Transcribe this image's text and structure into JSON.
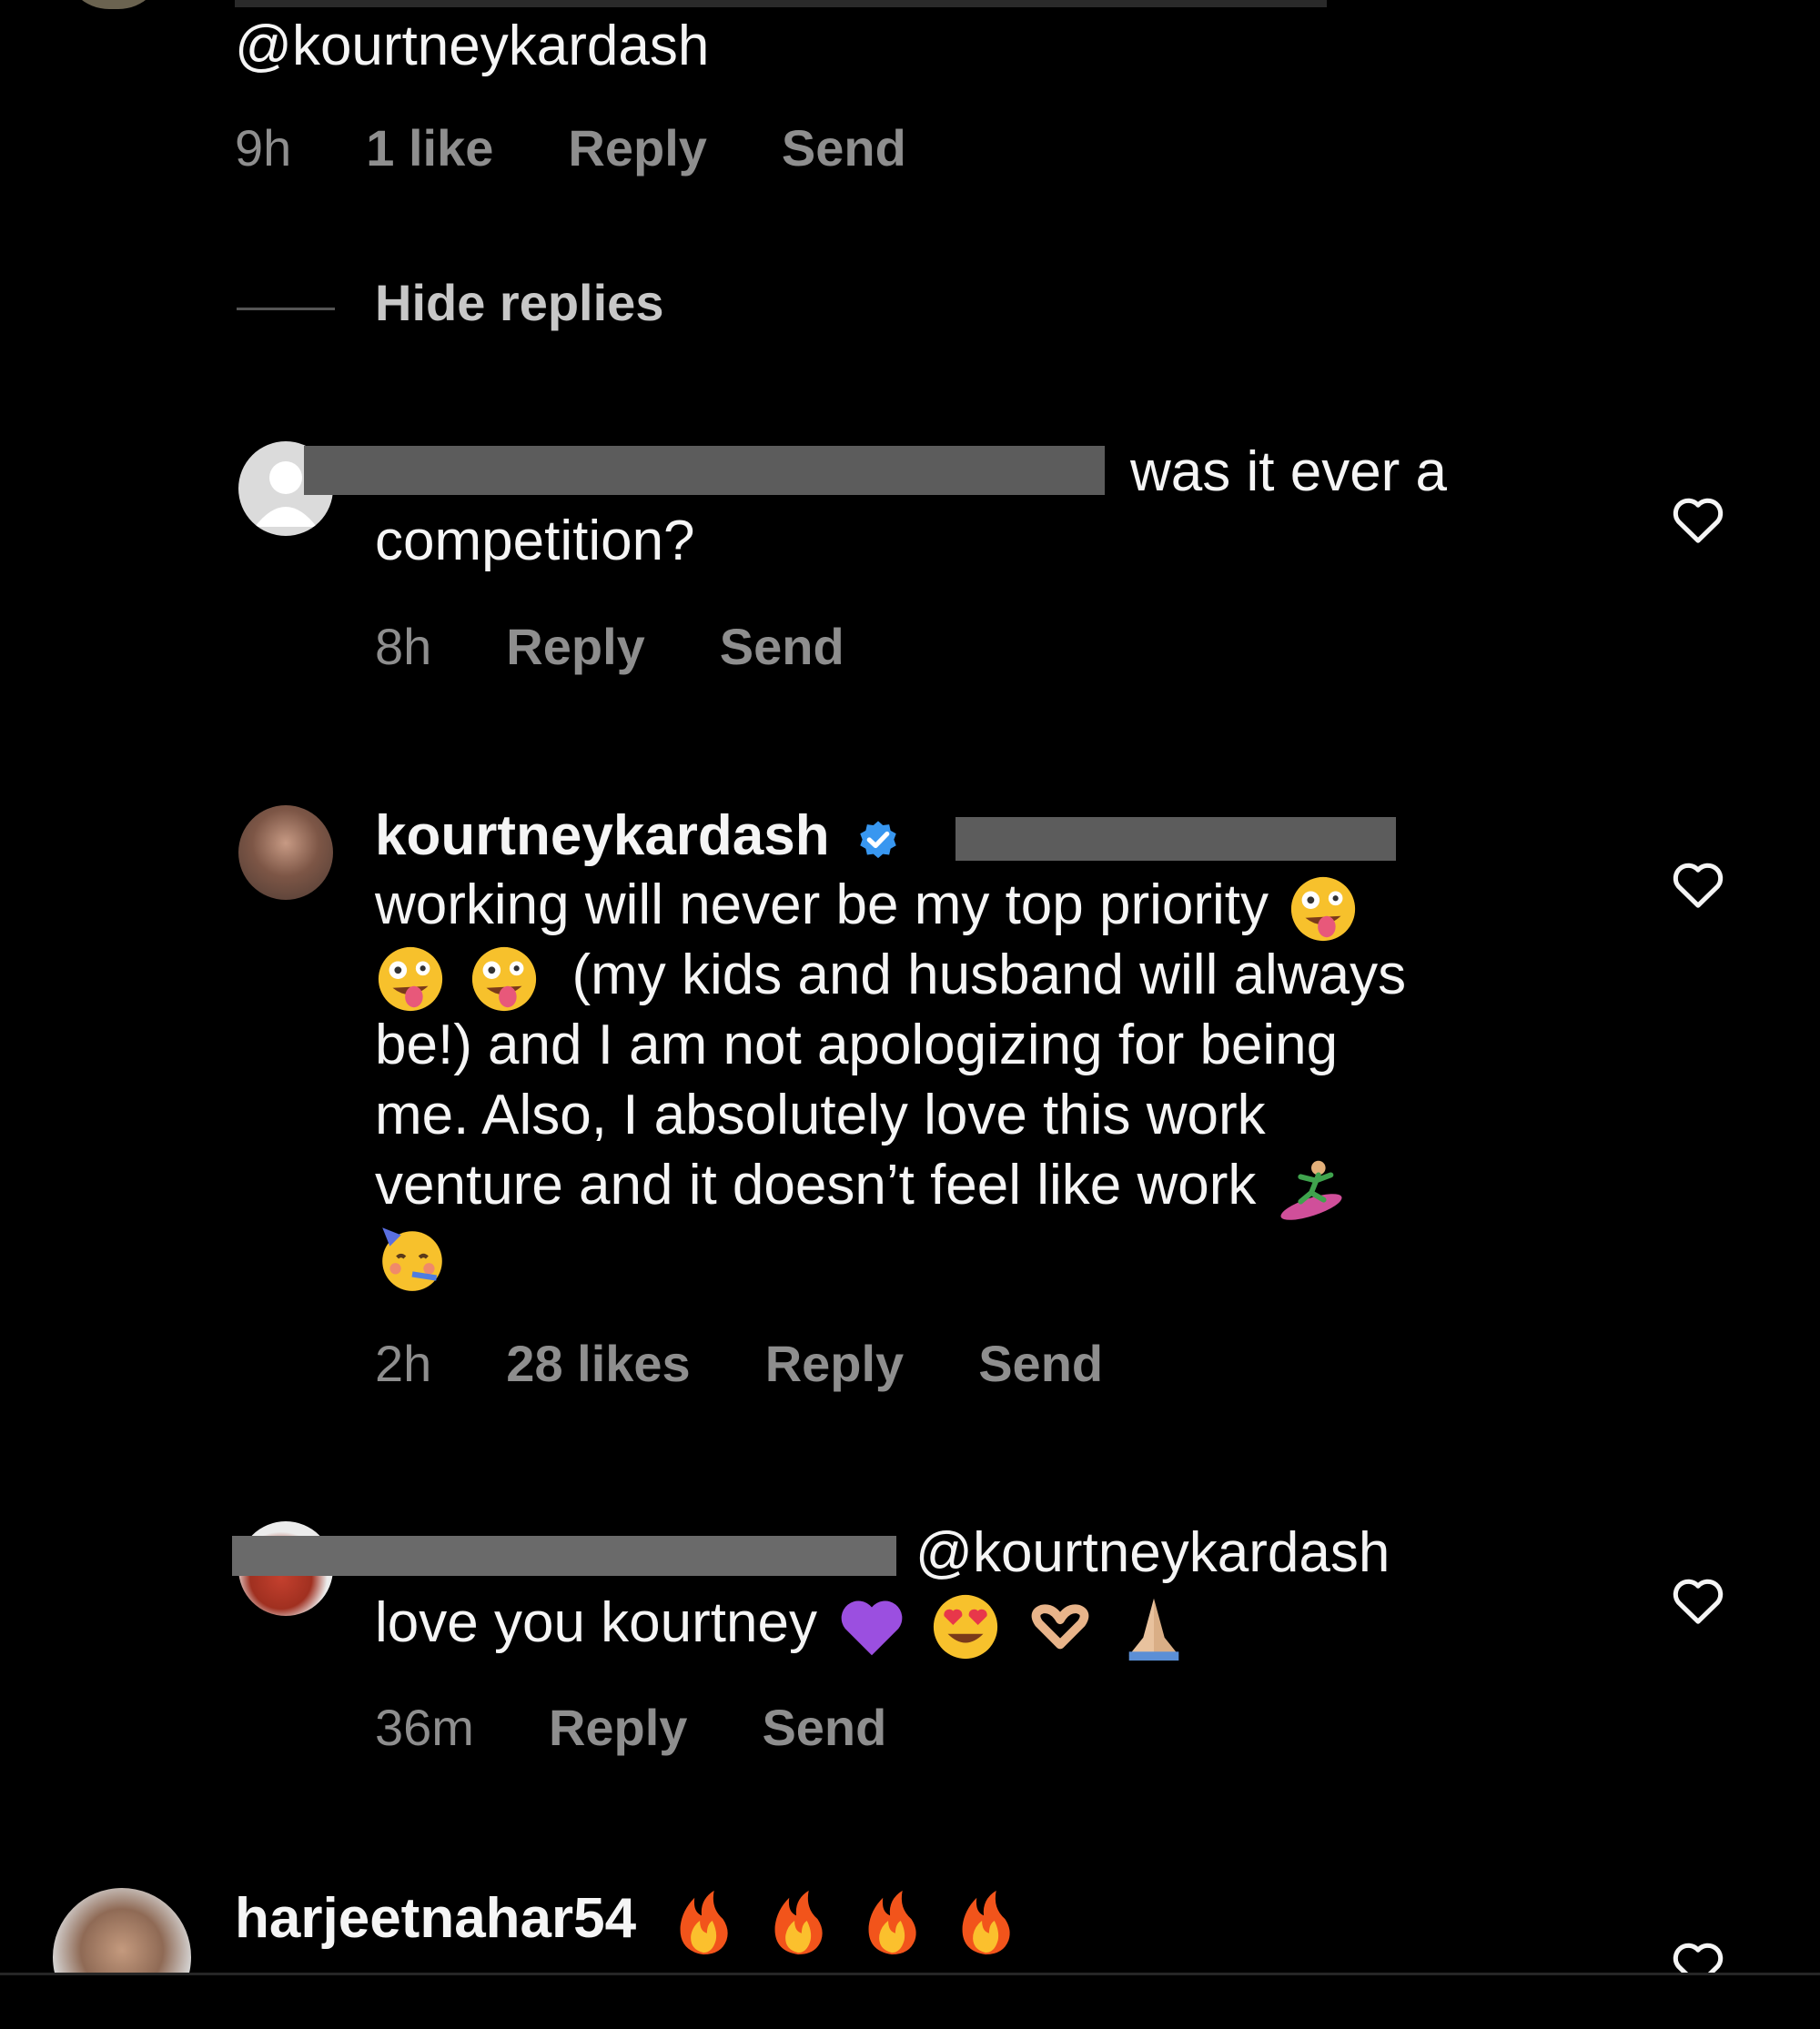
{
  "thread": {
    "top_comment": {
      "mention_line": "@kourtneykardash",
      "time": "9h",
      "likes": "1 like",
      "reply": "Reply",
      "send": "Send"
    },
    "hide_replies": "Hide replies"
  },
  "replies": [
    {
      "text_line1": "was it ever a",
      "text_line2": "competition?",
      "time": "8h",
      "reply": "Reply",
      "send": "Send"
    },
    {
      "username": "kourtneykardash",
      "lines": [
        "working will never be my top priority",
        "(my kids and husband will always",
        "be!) and I am not apologizing for being",
        "me. Also, I absolutely love this work",
        "venture and it doesn’t feel like work"
      ],
      "time": "2h",
      "likes": "28 likes",
      "reply": "Reply",
      "send": "Send"
    },
    {
      "mention": "@kourtneykardash",
      "text": "love you kourtney",
      "time": "36m",
      "reply": "Reply",
      "send": "Send"
    }
  ],
  "next_comment": {
    "username": "harjeetnahar54"
  },
  "icons": {
    "like": "heart-outline-icon",
    "verified": "verified-badge-icon"
  },
  "colors": {
    "background": "#000000",
    "text": "#f5f5f5",
    "meta": "#8e8e8e",
    "verified": "#3897f0"
  }
}
